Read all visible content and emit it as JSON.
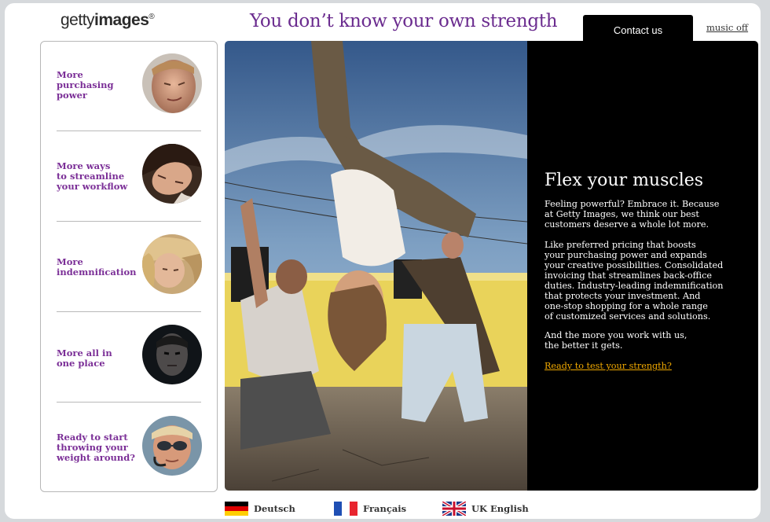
{
  "header": {
    "logo_light": "getty",
    "logo_bold": "images",
    "logo_reg": "®",
    "headline": "You don’t know your own strength",
    "contact_label": "Contact us",
    "music_label": "music off"
  },
  "sidebar": {
    "items": [
      {
        "label": "More\npurchasing\npower",
        "avatar": "boy-squinting-photo"
      },
      {
        "label": "More ways\nto streamline\nyour workflow",
        "avatar": "woman-upside-down-photo"
      },
      {
        "label": "More\nindemnification",
        "avatar": "girl-blonde-photo"
      },
      {
        "label": "More all in\none place",
        "avatar": "man-dark-photo"
      },
      {
        "label": "Ready to start\nthrowing your\nweight around?",
        "avatar": "pilot-sunglasses-photo"
      }
    ]
  },
  "hero": {
    "image": "breakdancers-photo"
  },
  "panel": {
    "title": "Flex your muscles",
    "p1": "Feeling powerful? Embrace it. Because\nat Getty Images, we think our best\ncustomers deserve a whole lot more.",
    "p2": "Like preferred pricing that boosts\nyour purchasing power and expands\nyour creative possibilities. Consolidated\ninvoicing that streamlines back-office\nduties. Industry-leading indemnification\nthat protects your investment. And\none-stop shopping for a whole range\nof customized services and solutions.",
    "p3": "And the more you work with us,\nthe better it gets.",
    "link": "Ready to test your strength?",
    "link_color": "#f0a800"
  },
  "languages": [
    {
      "label": "Deutsch",
      "flag": "german-flag-icon"
    },
    {
      "label": "Français",
      "flag": "french-flag-icon"
    },
    {
      "label": "UK English",
      "flag": "uk-flag-icon"
    }
  ],
  "colors": {
    "accent_purple": "#7b2f97",
    "panel_bg": "#000000"
  }
}
